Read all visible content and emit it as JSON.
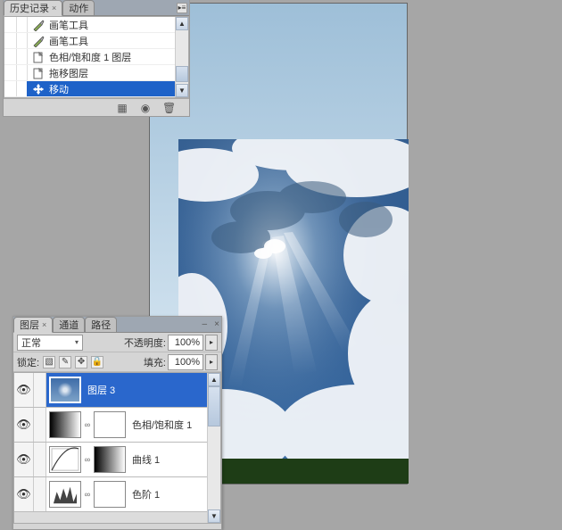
{
  "history_panel": {
    "tabs": {
      "history": "历史记录",
      "actions": "动作"
    },
    "items": [
      {
        "label": "画笔工具",
        "icon": "brush-icon"
      },
      {
        "label": "画笔工具",
        "icon": "brush-icon"
      },
      {
        "label": "色相/饱和度 1 图层",
        "icon": "new-layer-icon"
      },
      {
        "label": "拖移图层",
        "icon": "new-layer-icon"
      },
      {
        "label": "移动",
        "icon": "move-icon"
      }
    ],
    "footer": {
      "doc": "▦",
      "snap": "◉",
      "trash": "🗑"
    }
  },
  "layers_panel": {
    "tabs": {
      "layers": "图层",
      "channels": "通道",
      "paths": "路径"
    },
    "blend_mode": "正常",
    "opacity_label": "不透明度:",
    "opacity_value": "100%",
    "lock_label": "锁定:",
    "fill_label": "填充:",
    "fill_value": "100%",
    "layers": [
      {
        "label": "图层 3",
        "selected": true
      },
      {
        "label": "色相/饱和度 1"
      },
      {
        "label": "曲线 1"
      },
      {
        "label": "色阶 1"
      }
    ]
  }
}
